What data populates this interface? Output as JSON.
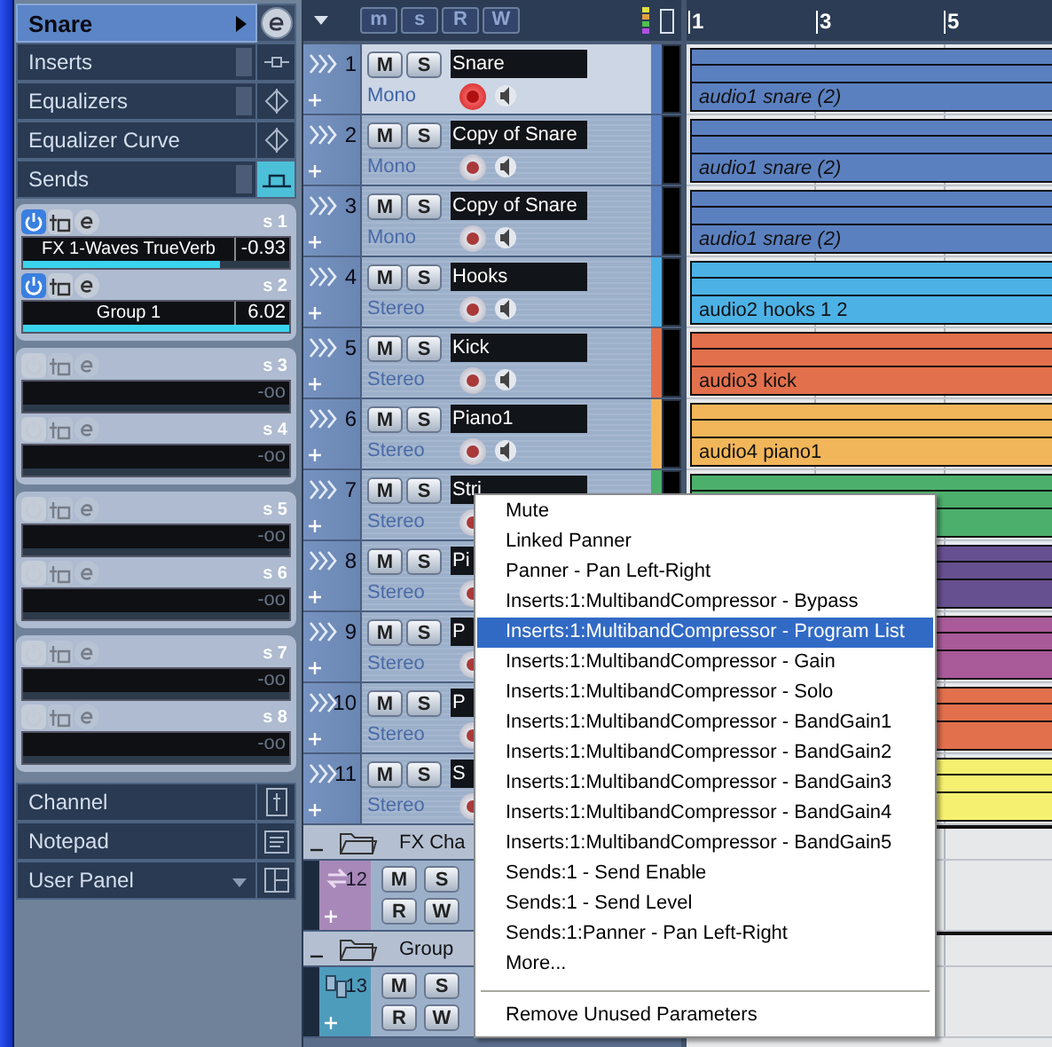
{
  "inspector": {
    "track_name": "Snare",
    "sections": [
      {
        "label": "Inserts",
        "kind": "inserts",
        "active": false
      },
      {
        "label": "Equalizers",
        "kind": "eq",
        "active": false
      },
      {
        "label": "Equalizer Curve",
        "kind": "eq",
        "active": false
      },
      {
        "label": "Sends",
        "kind": "sends",
        "active": true
      }
    ],
    "sends": [
      {
        "label": "s 1",
        "on": true,
        "destination": "FX 1-Waves TrueVerb",
        "value": "-0.93",
        "level": 0.74
      },
      {
        "label": "s 2",
        "on": true,
        "destination": "Group 1",
        "value": "6.02",
        "level": 1
      },
      {
        "label": "s 3",
        "on": false,
        "value": "-oo",
        "level": 0
      },
      {
        "label": "s 4",
        "on": false,
        "value": "-oo",
        "level": 0
      },
      {
        "label": "s 5",
        "on": false,
        "value": "-oo",
        "level": 0
      },
      {
        "label": "s 6",
        "on": false,
        "value": "-oo",
        "level": 0
      },
      {
        "label": "s 7",
        "on": false,
        "value": "-oo",
        "level": 0
      },
      {
        "label": "s 8",
        "on": false,
        "value": "-oo",
        "level": 0
      }
    ],
    "bottom_sections": [
      {
        "label": "Channel",
        "kind": "channel"
      },
      {
        "label": "Notepad",
        "kind": "notepad"
      },
      {
        "label": "User Panel",
        "kind": "user_panel"
      }
    ]
  },
  "toolbar": {
    "buttons": [
      "m",
      "s",
      "R",
      "W"
    ]
  },
  "ruler": {
    "marks": [
      "1",
      "3",
      "5"
    ]
  },
  "tracks": [
    {
      "kind": "audio",
      "number": "1",
      "name": "Snare",
      "io": "Mono",
      "color": "#5b80c0",
      "selected": true,
      "record": true,
      "buttons": [
        "M",
        "S"
      ],
      "event_label": "audio1 snare (2)",
      "event_italic": true
    },
    {
      "kind": "audio",
      "number": "2",
      "name": "Copy of Snare",
      "io": "Mono",
      "color": "#5b80c0",
      "selected": false,
      "record": false,
      "buttons": [
        "M",
        "S"
      ],
      "event_label": "audio1 snare (2)",
      "event_italic": true
    },
    {
      "kind": "audio",
      "number": "3",
      "name": "Copy of Snare",
      "io": "Mono",
      "color": "#5b80c0",
      "selected": false,
      "record": false,
      "buttons": [
        "M",
        "S"
      ],
      "event_label": "audio1 snare (2)",
      "event_italic": true
    },
    {
      "kind": "audio",
      "number": "4",
      "name": "Hooks",
      "io": "Stereo",
      "color": "#4cb2e6",
      "selected": false,
      "record": false,
      "buttons": [
        "M",
        "S"
      ],
      "event_label": "audio2 hooks 1 2",
      "event_italic": false
    },
    {
      "kind": "audio",
      "number": "5",
      "name": "Kick",
      "io": "Stereo",
      "color": "#e2704c",
      "selected": false,
      "record": false,
      "buttons": [
        "M",
        "S"
      ],
      "event_label": "audio3 kick",
      "event_italic": false
    },
    {
      "kind": "audio",
      "number": "6",
      "name": "Piano1",
      "io": "Stereo",
      "color": "#f2b65a",
      "selected": false,
      "record": false,
      "buttons": [
        "M",
        "S"
      ],
      "event_label": "audio4 piano1",
      "event_italic": false
    },
    {
      "kind": "audio",
      "number": "7",
      "name": "Stri",
      "io": "Stereo",
      "color": "#4caf6c",
      "selected": false,
      "record": false,
      "buttons": [
        "M",
        "S"
      ]
    },
    {
      "kind": "audio",
      "number": "8",
      "name": "Pi",
      "io": "Stereo",
      "color": "#66508f",
      "selected": false,
      "record": false,
      "buttons": [
        "M",
        "S"
      ]
    },
    {
      "kind": "audio",
      "number": "9",
      "name": "P",
      "io": "Stereo",
      "color": "#a95a98",
      "selected": false,
      "record": false,
      "buttons": [
        "M",
        "S"
      ]
    },
    {
      "kind": "audio",
      "number": "10",
      "name": "P",
      "io": "Stereo",
      "color": "#e2704c",
      "selected": false,
      "record": false,
      "buttons": [
        "M",
        "S"
      ]
    },
    {
      "kind": "audio",
      "number": "11",
      "name": "S",
      "io": "Stereo",
      "color": "#f6f070",
      "selected": false,
      "record": false,
      "buttons": [
        "M",
        "S"
      ]
    },
    {
      "kind": "folder",
      "name": "FX Cha"
    },
    {
      "kind": "fx",
      "number": "12",
      "color": "#a888b8",
      "buttons": [
        "M",
        "S",
        "R",
        "W"
      ]
    },
    {
      "kind": "folder",
      "name": "Group"
    },
    {
      "kind": "group",
      "number": "13",
      "color": "#4e9cbc",
      "buttons": [
        "M",
        "S",
        "R",
        "W"
      ]
    }
  ],
  "context_menu": {
    "items": [
      {
        "label": "Mute",
        "selected": false
      },
      {
        "label": "Linked Panner",
        "selected": false
      },
      {
        "label": "Panner - Pan Left-Right",
        "selected": false
      },
      {
        "label": "Inserts:1:MultibandCompressor - Bypass",
        "selected": false
      },
      {
        "label": "Inserts:1:MultibandCompressor - Program List",
        "selected": true
      },
      {
        "label": "Inserts:1:MultibandCompressor - Gain",
        "selected": false
      },
      {
        "label": "Inserts:1:MultibandCompressor - Solo",
        "selected": false
      },
      {
        "label": "Inserts:1:MultibandCompressor - BandGain1",
        "selected": false
      },
      {
        "label": "Inserts:1:MultibandCompressor - BandGain2",
        "selected": false
      },
      {
        "label": "Inserts:1:MultibandCompressor - BandGain3",
        "selected": false
      },
      {
        "label": "Inserts:1:MultibandCompressor - BandGain4",
        "selected": false
      },
      {
        "label": "Inserts:1:MultibandCompressor - BandGain5",
        "selected": false
      },
      {
        "label": "Sends:1 - Send Enable",
        "selected": false
      },
      {
        "label": "Sends:1 - Send Level",
        "selected": false
      },
      {
        "label": "Sends:1:Panner - Pan Left-Right",
        "selected": false
      },
      {
        "label": "More...",
        "selected": false
      }
    ],
    "footer_item": "Remove Unused Parameters"
  }
}
